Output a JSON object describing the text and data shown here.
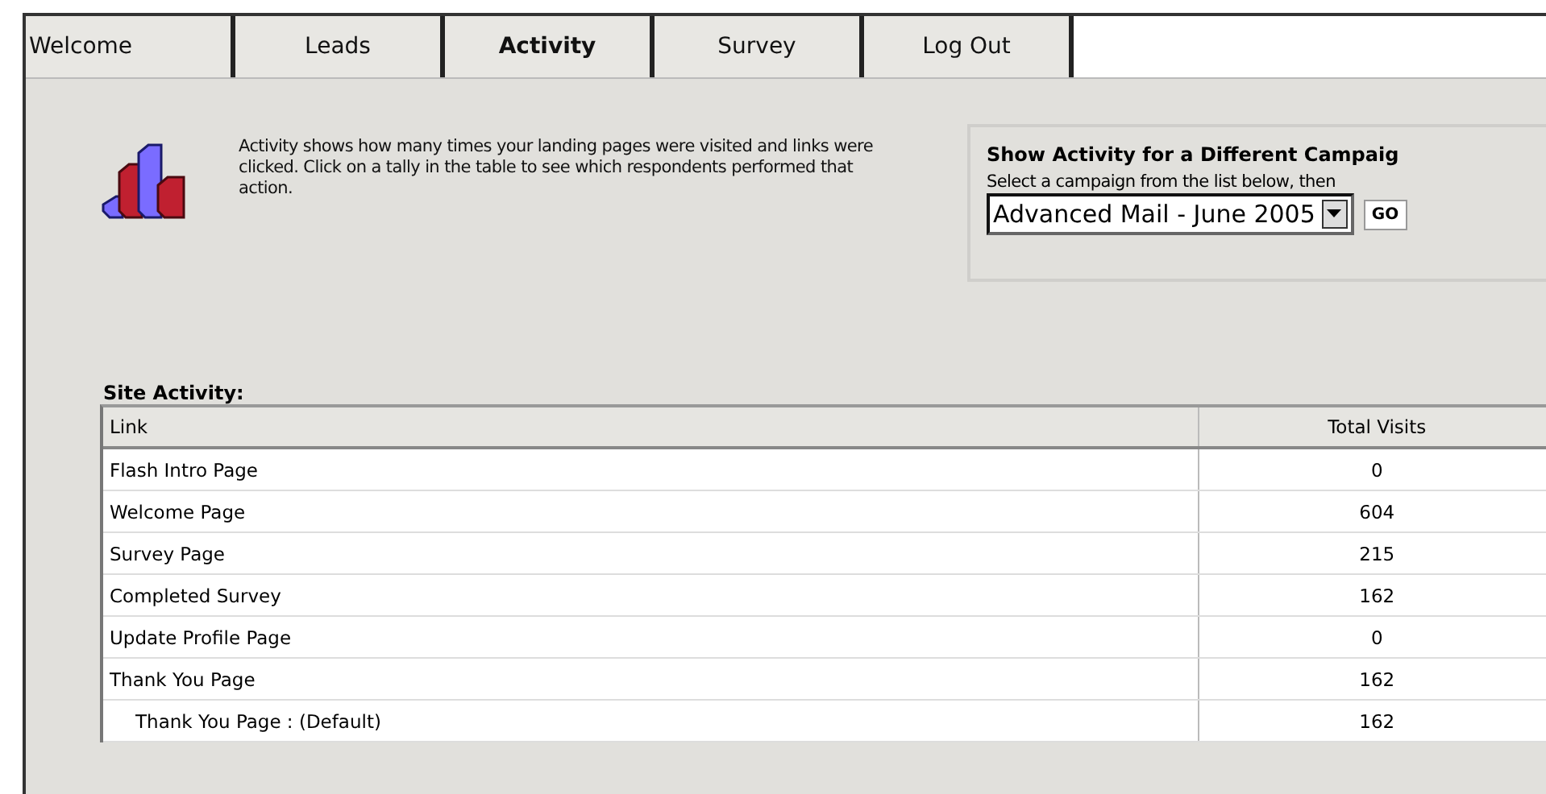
{
  "tabs": [
    {
      "label": "Welcome",
      "selected": false
    },
    {
      "label": "Leads",
      "selected": false
    },
    {
      "label": "Activity",
      "selected": true
    },
    {
      "label": "Survey",
      "selected": false
    },
    {
      "label": "Log Out",
      "selected": false
    }
  ],
  "intro": {
    "text": "Activity shows how many times your landing pages were visited and links were clicked. Click on a tally in the table to see which respondents performed that action."
  },
  "campaign_panel": {
    "title": "Show Activity for a Different Campaig",
    "instruction": "Select a campaign from the list below, then",
    "campaign_select": "Advanced Mail - June 2005",
    "go_button": "GO"
  },
  "site_activity": {
    "title": "Site Activity:",
    "columns": [
      "Link",
      "Total Visits"
    ],
    "rows": [
      {
        "link": "Flash Intro Page",
        "total_visits": "0"
      },
      {
        "link": "Welcome Page",
        "total_visits": "604"
      },
      {
        "link": "Survey Page",
        "total_visits": "215"
      },
      {
        "link": "Completed Survey",
        "total_visits": "162"
      },
      {
        "link": "Update Profile Page",
        "total_visits": "0"
      },
      {
        "link": "Thank You Page",
        "total_visits": "162",
        "children": [
          {
            "link": "Thank You Page : (Default)",
            "total_visits": "162"
          }
        ]
      }
    ]
  }
}
